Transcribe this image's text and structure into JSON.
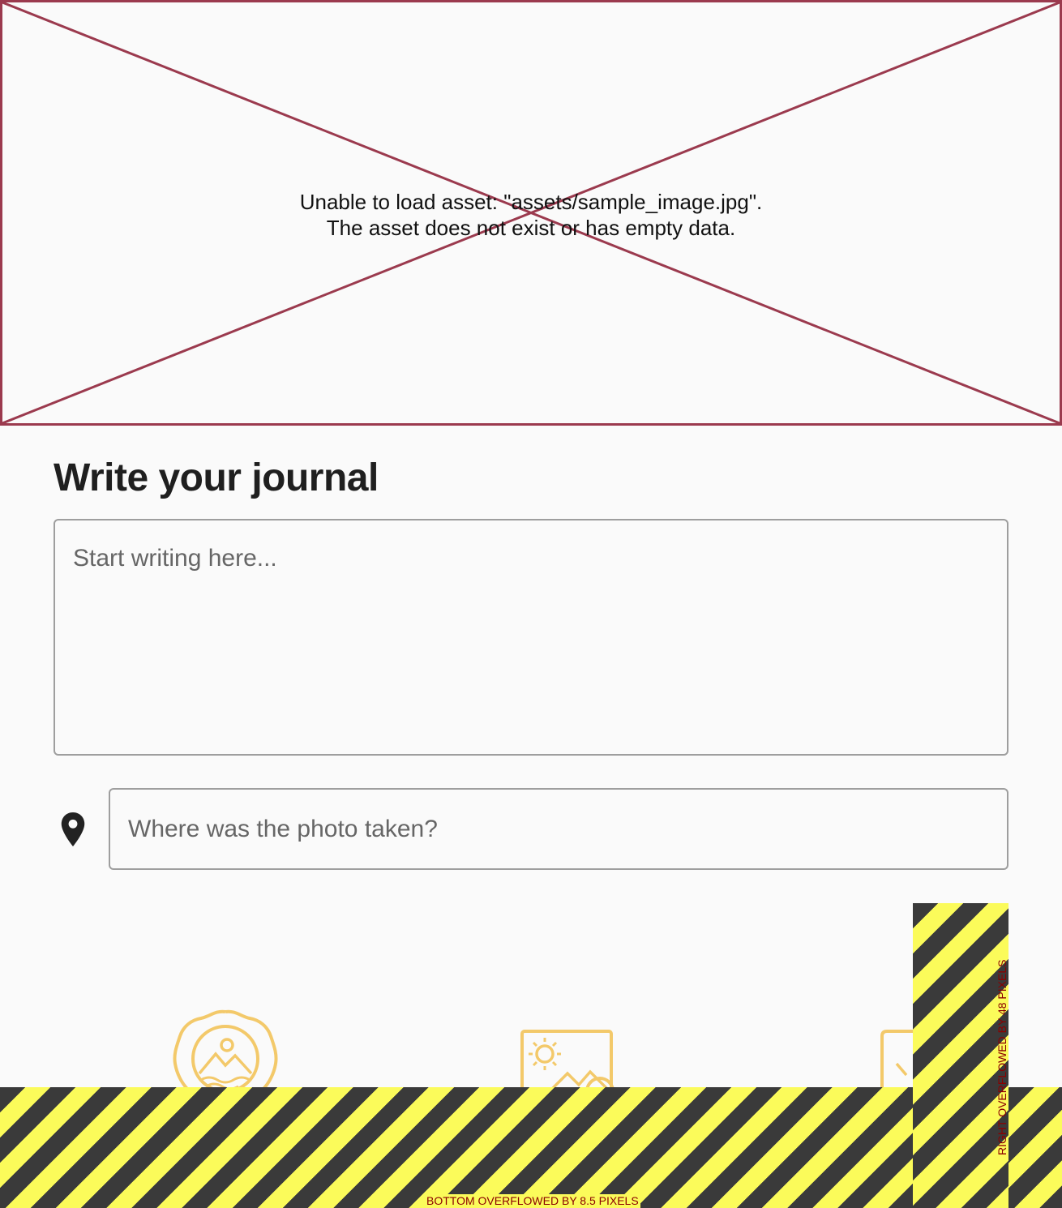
{
  "image_error": {
    "line1": "Unable to load asset: \"assets/sample_image.jpg\".",
    "line2": "The asset does not exist or has empty data."
  },
  "journal": {
    "heading": "Write your journal",
    "placeholder": "Start writing here..."
  },
  "location": {
    "placeholder": "Where was the photo taken?",
    "icon": "location-pin-icon"
  },
  "filters": [
    {
      "name": "vintage-filter",
      "icon": "badge-photo-icon"
    },
    {
      "name": "sunny-filter",
      "icon": "sun-photo-icon"
    },
    {
      "name": "third-filter",
      "icon": "photo-check-icon"
    }
  ],
  "overflow": {
    "bottom_label": "BOTTOM OVERFLOWED BY 8.5 PIXELS",
    "right_label": "RIGHT OVERFLOWED BY 48 PIXELS"
  },
  "colors": {
    "error_border": "#9b3a4e",
    "filter_icon": "#f3c96a",
    "stripe_dark": "#3a3a3a",
    "stripe_light": "#fbfb5a",
    "overflow_text": "#8b0000"
  }
}
